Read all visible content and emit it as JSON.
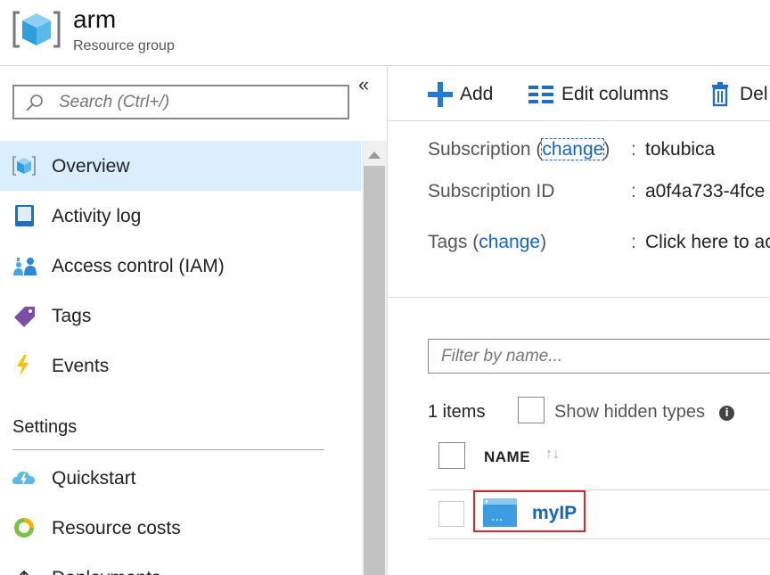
{
  "header": {
    "title": "arm",
    "subtitle": "Resource group",
    "icon": "resource-group-cube-icon"
  },
  "sidebar": {
    "search_placeholder": "Search (Ctrl+/)",
    "collapse_label": "«",
    "items": [
      {
        "label": "Overview",
        "icon": "cube-icon",
        "active": true
      },
      {
        "label": "Activity log",
        "icon": "log-book-icon"
      },
      {
        "label": "Access control (IAM)",
        "icon": "people-icon"
      },
      {
        "label": "Tags",
        "icon": "tag-icon"
      },
      {
        "label": "Events",
        "icon": "lightning-icon"
      }
    ],
    "settings_title": "Settings",
    "settings_items": [
      {
        "label": "Quickstart",
        "icon": "cloud-quickstart-icon"
      },
      {
        "label": "Resource costs",
        "icon": "cost-circle-icon"
      },
      {
        "label": "Deployments",
        "icon": "upload-arrow-icon"
      }
    ]
  },
  "toolbar": {
    "add_label": "Add",
    "edit_columns_label": "Edit columns",
    "delete_label": "Del"
  },
  "essentials": {
    "subscription_label": "Subscription",
    "subscription_open": "(",
    "subscription_change": "change",
    "subscription_close": ")",
    "subscription_value": "tokubica",
    "subscription_id_label": "Subscription ID",
    "subscription_id_value": "a0f4a733-4fce",
    "tags_label": "Tags",
    "tags_open": "(",
    "tags_change": "change",
    "tags_close": ")",
    "tags_value": "Click here to ac",
    "separator": ":"
  },
  "resources": {
    "filter_placeholder": "Filter by name...",
    "count": "1 items",
    "show_hidden_label": "Show hidden types",
    "column_name": "NAME",
    "rows": [
      {
        "name": "myIP",
        "icon": "public-ip-icon"
      }
    ]
  },
  "colors": {
    "accent": "#1565c0",
    "active_bg": "#daeefd",
    "highlight": "#d9262c"
  }
}
